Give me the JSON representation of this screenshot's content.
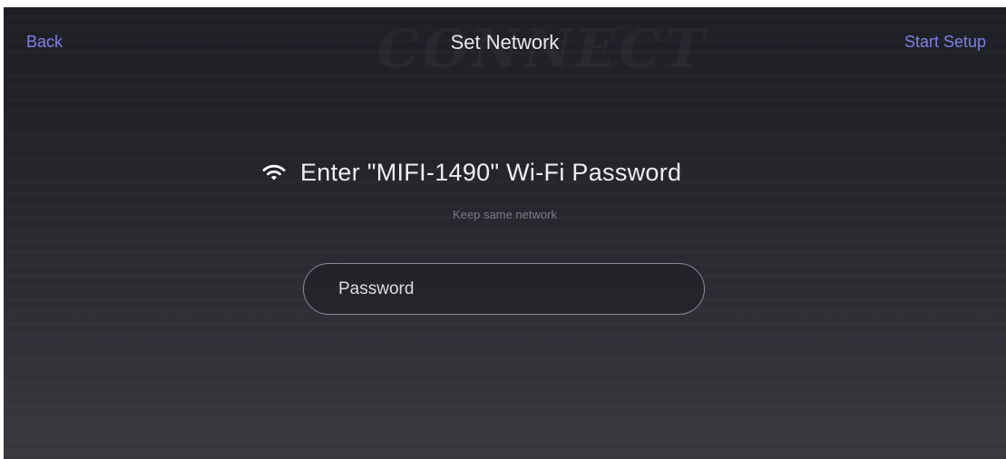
{
  "header": {
    "back_label": "Back",
    "title": "Set Network",
    "start_label": "Start Setup"
  },
  "main": {
    "heading": "Enter \"MIFI-1490\" Wi-Fi Password",
    "subtitle": "Keep same network",
    "password_field": {
      "placeholder": "Password",
      "value": ""
    }
  },
  "icons": {
    "wifi": "wifi-icon"
  },
  "colors": {
    "accent": "#7d7fe6",
    "text": "#e8e8ec",
    "muted": "#7a7b82",
    "background": "#24252b"
  }
}
